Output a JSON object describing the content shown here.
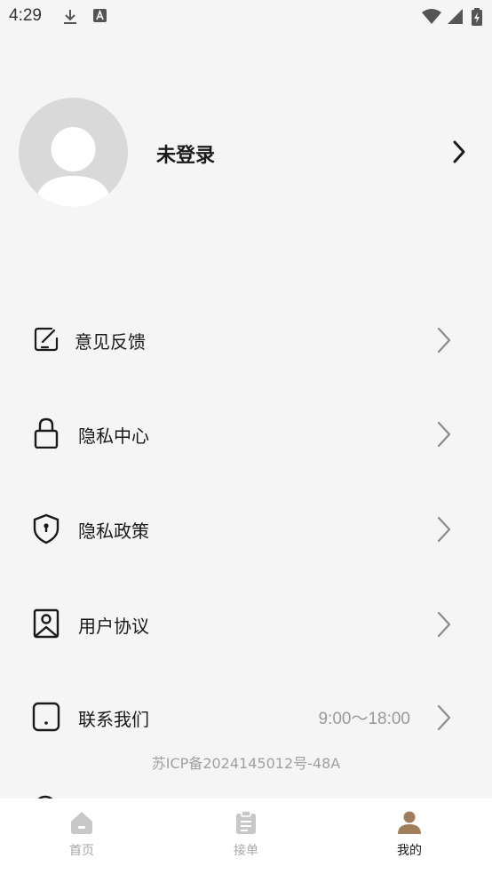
{
  "status_bar": {
    "time": "4:29"
  },
  "profile": {
    "name": "未登录"
  },
  "menu": {
    "items": [
      {
        "label": "意见反馈",
        "icon": "feedback-edit-icon"
      },
      {
        "label": "隐私中心",
        "icon": "lock-icon"
      },
      {
        "label": "隐私政策",
        "icon": "shield-icon"
      },
      {
        "label": "用户协议",
        "icon": "agreement-bookmark-icon"
      },
      {
        "label": "联系我们",
        "icon": "phone-icon",
        "value": "9:00～18:00"
      }
    ]
  },
  "footer": {
    "icp": "苏ICP备2024145012号-48A"
  },
  "tabbar": {
    "tabs": [
      {
        "label": "首页",
        "icon": "home-icon",
        "active": false
      },
      {
        "label": "接单",
        "icon": "clipboard-icon",
        "active": false
      },
      {
        "label": "我的",
        "icon": "user-icon",
        "active": true
      }
    ]
  },
  "colors": {
    "accent": "#a27f5b",
    "inactive": "#c8c8c8",
    "background": "#f5f5f5"
  }
}
